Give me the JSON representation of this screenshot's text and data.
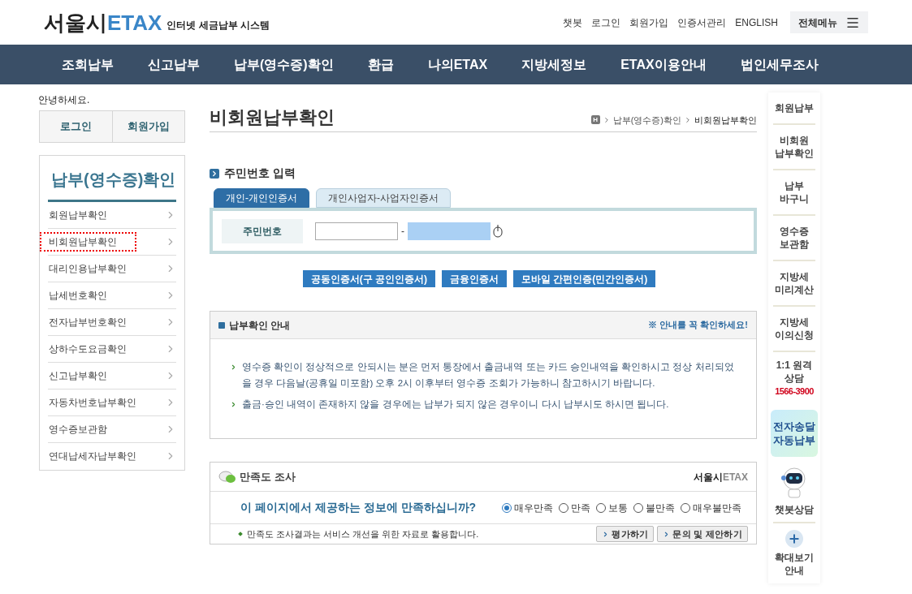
{
  "header": {
    "logo_main": "서울시",
    "logo_accent": "ETAX",
    "tagline": "인터넷 세금납부 시스템",
    "links": [
      "챗봇",
      "로그인",
      "회원가입",
      "인증서관리",
      "ENGLISH"
    ],
    "menu_button": "전체메뉴"
  },
  "nav": [
    "조회납부",
    "신고납부",
    "납부(영수증)확인",
    "환급",
    "나의ETAX",
    "지방세정보",
    "ETAX이용안내",
    "법인세무조사"
  ],
  "sidebar": {
    "greeting": "안녕하세요.",
    "auth_buttons": [
      "로그인",
      "회원가입"
    ],
    "title": "납부(영수증)확인",
    "items": [
      {
        "label": "회원납부확인",
        "selected": false
      },
      {
        "label": "비회원납부확인",
        "selected": true
      },
      {
        "label": "대리인용납부확인",
        "selected": false
      },
      {
        "label": "납세번호확인",
        "selected": false
      },
      {
        "label": "전자납부번호확인",
        "selected": false
      },
      {
        "label": "상하수도요금확인",
        "selected": false
      },
      {
        "label": "신고납부확인",
        "selected": false
      },
      {
        "label": "자동차번호납부확인",
        "selected": false
      },
      {
        "label": "영수증보관함",
        "selected": false
      },
      {
        "label": "연대납세자납부확인",
        "selected": false
      }
    ]
  },
  "page": {
    "title": "비회원납부확인",
    "breadcrumb": {
      "home": "H",
      "items": [
        "납부(영수증)확인",
        "비회원납부확인"
      ]
    }
  },
  "id_section": {
    "heading": "주민번호 입력",
    "tabs": [
      {
        "label": "개인-개인인증서",
        "selected": true
      },
      {
        "label": "개인사업자-사업자인증서",
        "selected": false
      }
    ],
    "field_label": "주민번호",
    "separator": "-",
    "buttons": [
      "공동인증서(구 공인인증서)",
      "금융인증서",
      "모바일 간편인증(민간인증서)"
    ]
  },
  "notice": {
    "title": "납부확인 안내",
    "alert": "※ 안내를 꼭 확인하세요!",
    "items": [
      "영수증 확인이 정상적으로 안되시는 분은 먼저 통장에서 출금내역 또는 카드 승인내역을 확인하시고 정상 처리되었을 경우 다음날(공휴일 미포함) 오후 2시 이후부터 영수증 조회가 가능하니 참고하시기 바랍니다.",
      "출금·승인 내역이 존재하지 않을 경우에는 납부가 되지 않은 경우이니 다시 납부시도 하시면 됩니다."
    ]
  },
  "survey": {
    "title": "만족도 조사",
    "brand_main": "서울시",
    "brand_accent": "ETAX",
    "question": "이 페이지에서 제공하는 정보에 만족하십니까?",
    "options": [
      {
        "label": "매우만족",
        "selected": true
      },
      {
        "label": "만족",
        "selected": false
      },
      {
        "label": "보통",
        "selected": false
      },
      {
        "label": "불만족",
        "selected": false
      },
      {
        "label": "매우불만족",
        "selected": false
      }
    ],
    "note": "만족도 조사결과는 서비스 개선을 위한 자료로 활용합니다.",
    "buttons": [
      "평가하기",
      "문의 및 제안하기"
    ]
  },
  "quick_menu": [
    {
      "kind": "link",
      "lines": [
        "회원납부"
      ]
    },
    {
      "kind": "link",
      "lines": [
        "비회원",
        "납부확인"
      ]
    },
    {
      "kind": "link",
      "lines": [
        "납부",
        "바구니"
      ]
    },
    {
      "kind": "link",
      "lines": [
        "영수증",
        "보관함"
      ]
    },
    {
      "kind": "link",
      "lines": [
        "지방세",
        "미리계산"
      ]
    },
    {
      "kind": "link",
      "lines": [
        "지방세",
        "이의신청"
      ]
    },
    {
      "kind": "phone",
      "lines": [
        "1:1 원격",
        "상담"
      ],
      "phone": "1566-3900"
    },
    {
      "kind": "highlight",
      "lines": [
        "전자송달",
        "자동납부"
      ]
    },
    {
      "kind": "chatbot",
      "lines": [
        "챗봇상담"
      ]
    },
    {
      "kind": "zoom",
      "lines": [
        "확대보기",
        "안내"
      ]
    }
  ]
}
